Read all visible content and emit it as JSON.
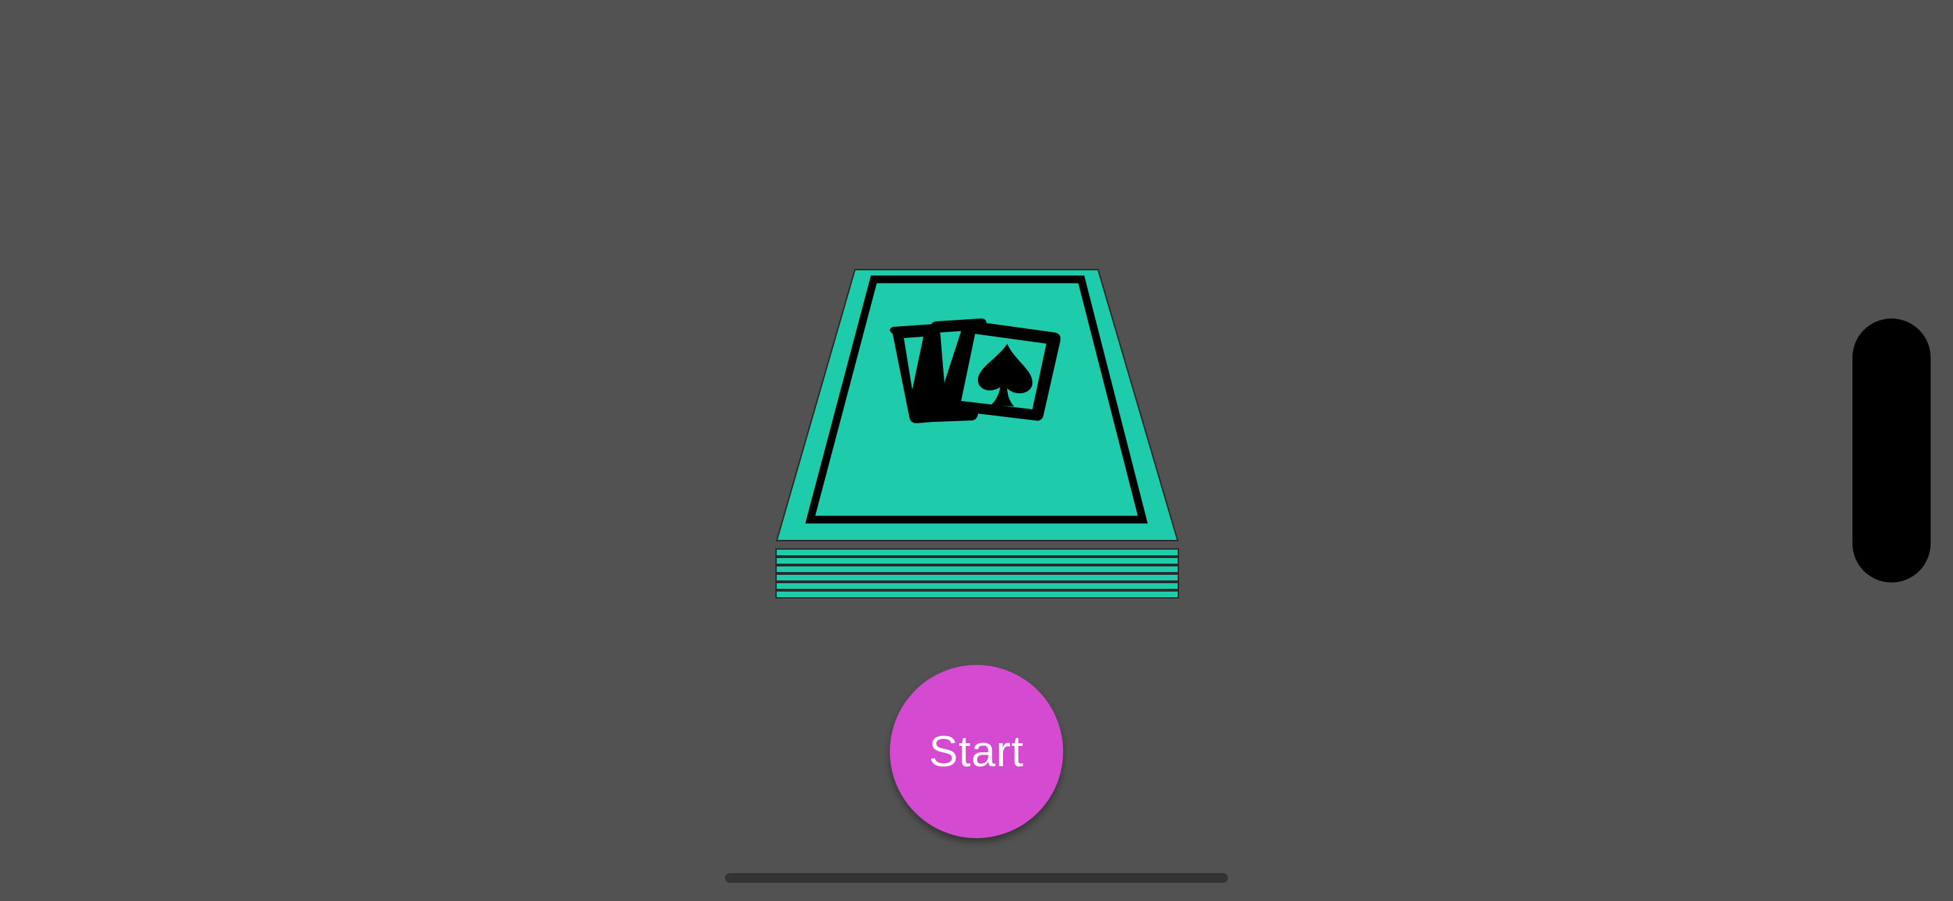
{
  "app": {
    "background_color": "#525252"
  },
  "deck": {
    "card_color": "#1ecbaa",
    "border_color": "#000000",
    "emblem_icon": "playing-cards-spade-icon",
    "stack_count": 6
  },
  "start_button": {
    "label": "Start",
    "color": "#d44ad0",
    "text_color": "#ffffff"
  },
  "system": {
    "camera_island_icon": "dynamic-island",
    "home_indicator": "home-indicator"
  }
}
